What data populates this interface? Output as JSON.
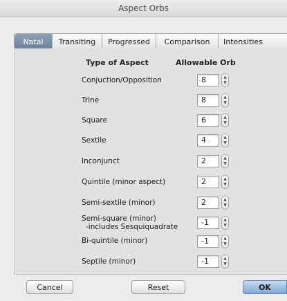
{
  "window": {
    "title": "Aspect Orbs"
  },
  "tabs": [
    {
      "label": "Natal",
      "active": true
    },
    {
      "label": "Transiting",
      "active": false
    },
    {
      "label": "Progressed",
      "active": false
    },
    {
      "label": "Comparison",
      "active": false
    },
    {
      "label": "Intensities",
      "active": false
    }
  ],
  "columns": {
    "aspect": "Type of Aspect",
    "orb": "Allowable Orb"
  },
  "rows": [
    {
      "label": "Conjuction/Opposition",
      "value": "8"
    },
    {
      "label": "Trine",
      "value": "8"
    },
    {
      "label": "Square",
      "value": "6"
    },
    {
      "label": "Sextile",
      "value": "4"
    },
    {
      "label": "Inconjunct",
      "value": "2"
    },
    {
      "label": "Quintile (minor aspect)",
      "value": "2"
    },
    {
      "label": "Semi-sextile (minor)",
      "value": "2"
    },
    {
      "label": "Semi-square (minor)",
      "sublabel": "-includes Sesquiquadrate",
      "value": "-1"
    },
    {
      "label": "Bi-quintile (minor)",
      "value": "-1"
    },
    {
      "label": "Septile (minor)",
      "value": "-1"
    }
  ],
  "buttons": {
    "cancel": "Cancel",
    "reset": "Reset",
    "ok": "OK"
  },
  "colors": {
    "active_tab": "#7a8fa6",
    "default_button": "#8fb5df"
  }
}
